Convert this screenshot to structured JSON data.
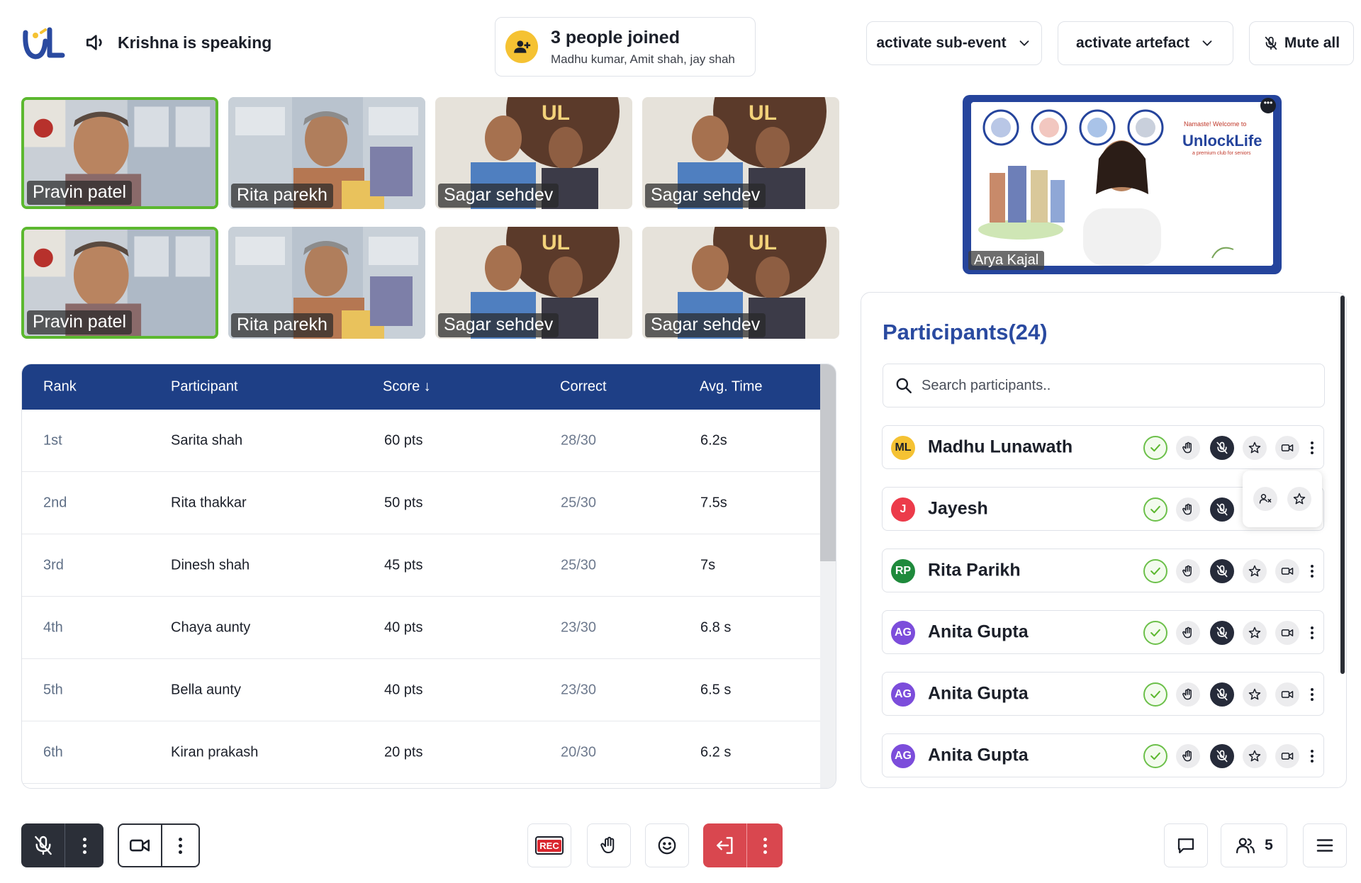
{
  "header": {
    "logo_text": "UL",
    "speaking_text": "Krishna is speaking",
    "joined_title": "3 people joined",
    "joined_names": "Madhu kumar, Amit shah, jay shah",
    "sub_event_label": "activate sub-event",
    "artefact_label": "activate artefact",
    "mute_all_label": "Mute all"
  },
  "tiles": [
    {
      "name": "Pravin patel",
      "active": true
    },
    {
      "name": "Rita parekh",
      "active": false
    },
    {
      "name": "Sagar sehdev",
      "active": false
    },
    {
      "name": "Sagar sehdev",
      "active": false
    },
    {
      "name": "Pravin patel",
      "active": true
    },
    {
      "name": "Rita parekh",
      "active": false
    },
    {
      "name": "Sagar sehdev",
      "active": false
    },
    {
      "name": "Sagar sehdev",
      "active": false
    }
  ],
  "leaderboard": {
    "columns": [
      "Rank",
      "Participant",
      "Score ↓",
      "Correct",
      "Avg. Time"
    ],
    "rows": [
      {
        "rank": "1st",
        "name": "Sarita shah",
        "score": "60 pts",
        "correct": "28/30",
        "time": "6.2s"
      },
      {
        "rank": "2nd",
        "name": "Rita thakkar",
        "score": "50 pts",
        "correct": "25/30",
        "time": "7.5s"
      },
      {
        "rank": "3rd",
        "name": "Dinesh shah",
        "score": "45 pts",
        "correct": "25/30",
        "time": "7s"
      },
      {
        "rank": "4th",
        "name": "Chaya aunty",
        "score": "40 pts",
        "correct": "23/30",
        "time": "6.8 s"
      },
      {
        "rank": "5th",
        "name": "Bella aunty",
        "score": "40 pts",
        "correct": "23/30",
        "time": "6.5 s"
      },
      {
        "rank": "6th",
        "name": "Kiran prakash",
        "score": "20 pts",
        "correct": "20/30",
        "time": "6.2 s"
      }
    ]
  },
  "presenter": {
    "name": "Arya Kajal",
    "slide_greeting": "Namaste! Welcome to",
    "slide_brand": "UnlockLife",
    "slide_tagline": "a premium club for seniors"
  },
  "participants": {
    "title": "Participants(24)",
    "search_placeholder": "Search participants..",
    "list": [
      {
        "initials": "ML",
        "name": "Madhu Lunawath",
        "color": "#f5c233",
        "initials_color": "#1b1f29"
      },
      {
        "initials": "J",
        "name": "Jayesh",
        "color": "#ec3b4a",
        "initials_color": "#ffffff"
      },
      {
        "initials": "RP",
        "name": "Rita Parikh",
        "color": "#1f8a3c",
        "initials_color": "#ffffff"
      },
      {
        "initials": "AG",
        "name": "Anita Gupta",
        "color": "#7c4ddb",
        "initials_color": "#ffffff"
      },
      {
        "initials": "AG",
        "name": "Anita Gupta",
        "color": "#7c4ddb",
        "initials_color": "#ffffff"
      },
      {
        "initials": "AG",
        "name": "Anita Gupta",
        "color": "#7c4ddb",
        "initials_color": "#ffffff"
      }
    ]
  },
  "bottom_bar": {
    "rec_label": "REC",
    "participants_count": "5"
  },
  "colors": {
    "primary": "#1e3f86",
    "accent_green": "#5cb82f",
    "leave_red": "#d9474f",
    "title_blue": "#2a4aa0"
  },
  "icons": [
    "speaker-icon",
    "add-person-icon",
    "chevron-down-icon",
    "mic-off-icon",
    "video-icon",
    "hand-icon",
    "emoji-icon",
    "leave-icon",
    "chat-icon",
    "people-icon",
    "menu-icon",
    "search-icon",
    "check-icon",
    "star-icon",
    "remove-person-icon"
  ]
}
